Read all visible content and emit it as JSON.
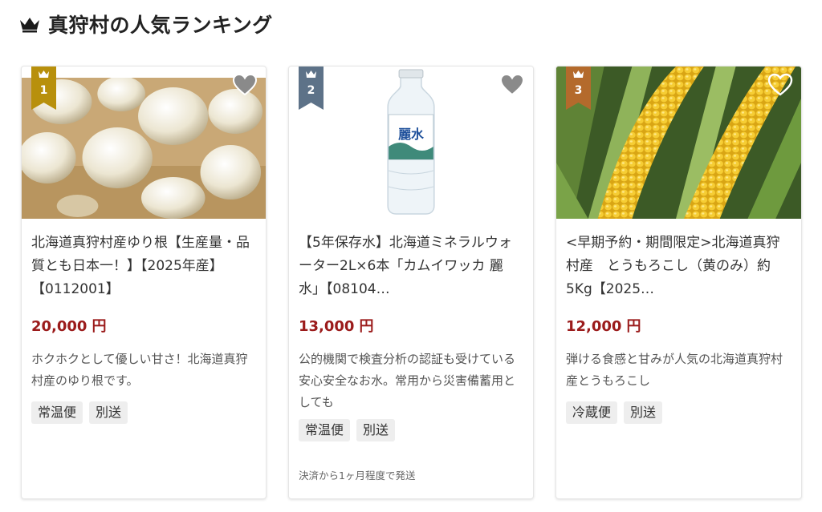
{
  "heading": {
    "title": "真狩村の人気ランキング",
    "icon": "crown-icon"
  },
  "colors": {
    "gold": "#b8900c",
    "silver": "#5d7288",
    "bronze": "#b46a2c",
    "price": "#9b1b1b"
  },
  "cards": [
    {
      "rank": "1",
      "rank_color": "gold",
      "title": "北海道真狩村産ゆり根【生産量・品質とも日本一！】【2025年産】【0112001】",
      "price": "20,000",
      "currency": "円",
      "description": "ホクホクとして優しい甘さ！北海道真狩村産のゆり根です。",
      "tags": [
        "常温便",
        "別送"
      ],
      "note": ""
    },
    {
      "rank": "2",
      "rank_color": "silver",
      "title": "【5年保存水】北海道ミネラルウォーター2L×6本「カムイワッカ 麗水」【08104…",
      "price": "13,000",
      "currency": "円",
      "description": "公的機関で検査分析の認証も受けている安心安全なお水。常用から災害備蓄用としても",
      "tags": [
        "常温便",
        "別送"
      ],
      "note": "決済から1ヶ月程度で発送",
      "bottle_label": "麗水"
    },
    {
      "rank": "3",
      "rank_color": "bronze",
      "title": "<早期予約・期間限定>北海道真狩村産　とうもろこし（黄のみ）約5Kg【2025…",
      "price": "12,000",
      "currency": "円",
      "description": "弾ける食感と甘みが人気の北海道真狩村産とうもろこし",
      "tags": [
        "冷蔵便",
        "別送"
      ],
      "note": ""
    }
  ]
}
